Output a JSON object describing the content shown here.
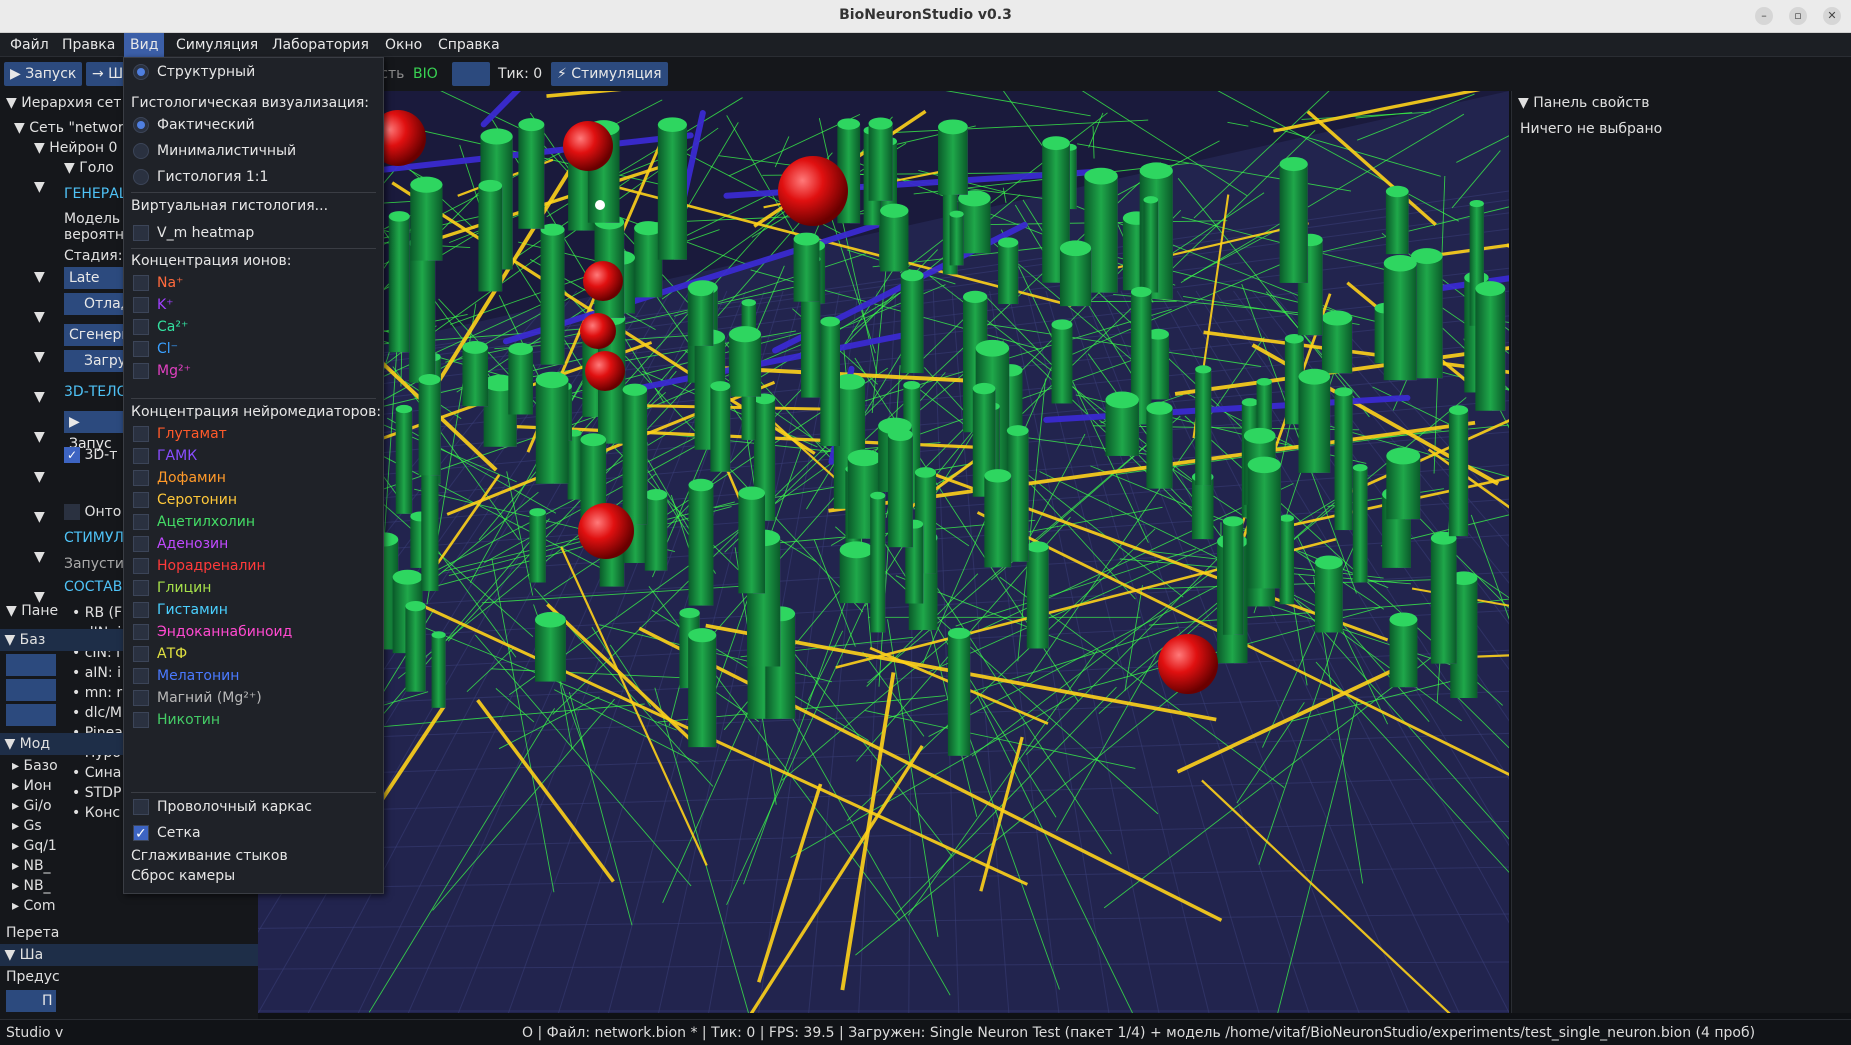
{
  "window": {
    "title": "BioNeuronStudio v0.3"
  },
  "menubar": [
    "Файл",
    "Правка",
    "Вид",
    "Симуляция",
    "Лаборатория",
    "Окно",
    "Справка"
  ],
  "toolbar": {
    "run": "▶ Запуск",
    "step": "→ Ш",
    "speed": "Скорость",
    "bio": "BIO",
    "tick": "Тик: 0",
    "stim": "⚡ Стимуляция"
  },
  "left_panel": {
    "hierarchy_header": "Иерархия сет",
    "network": "Сеть \"networ",
    "neuron": "Нейрон 0",
    "head": "Голо",
    "generator": "ГЕНЕРАЦ",
    "model": "Модель",
    "probability": "вероятн",
    "stage": "Стадия:",
    "late_tail": "Late Tai",
    "debug": "Отлад",
    "generate": "Сгенери",
    "load": "Загру",
    "threed_body": "3D-ТЕЛО",
    "run_btn": "▶ Запус",
    "threed_check": "3D-т",
    "onto": "Онто",
    "stim": "СТИМУЛ",
    "start": "Запусти",
    "composition": "СОСТАВ",
    "panel_header": "Пане",
    "list": [
      "RB (F",
      "dIN: i",
      "cIN: i",
      "aIN: i",
      "mn: r",
      "dlc/M",
      "Pinea",
      "Нуро",
      "Сина",
      "STDP",
      "Конс"
    ],
    "base": "Баз",
    "modifiers_header": "Мод",
    "tree": [
      "Базо",
      "Ион",
      "Gi/o",
      "Gs",
      "Gq/1",
      "NB_",
      "NB_",
      "Com"
    ],
    "drag_hint": "Перета",
    "template_header": "Ша",
    "preset": "Предус",
    "pyramidal_btn": "П"
  },
  "view_menu": {
    "structural": "Структурный",
    "histology_header": "Гистологическая визуализация:",
    "actual": "Фактический",
    "minimal": "Минималистичный",
    "histology11": "Гистология 1:1",
    "virtual_histology": "Виртуальная гистология...",
    "vm_heatmap": "V_m heatmap",
    "ion_header": "Концентрация ионов:",
    "ions": [
      {
        "label": "Na⁺",
        "color": "#ff6a3d"
      },
      {
        "label": "K⁺",
        "color": "#a040ff"
      },
      {
        "label": "Ca²⁺",
        "color": "#33e0a0"
      },
      {
        "label": "Cl⁻",
        "color": "#3aa0ff"
      },
      {
        "label": "Mg²⁺",
        "color": "#e040c0"
      }
    ],
    "nt_header": "Концентрация нейромедиаторов:",
    "neurotransmitters": [
      {
        "label": "Глутамат",
        "color": "#ff5a2a"
      },
      {
        "label": "ГАМК",
        "color": "#8a4dff"
      },
      {
        "label": "Дофамин",
        "color": "#ff9a2a"
      },
      {
        "label": "Серотонин",
        "color": "#ffc83a"
      },
      {
        "label": "Ацетилхолин",
        "color": "#44dd66"
      },
      {
        "label": "Аденозин",
        "color": "#c04aff"
      },
      {
        "label": "Норадреналин",
        "color": "#ff3a3a"
      },
      {
        "label": "Глицин",
        "color": "#a6e04a"
      },
      {
        "label": "Гистамин",
        "color": "#4ad0ff"
      },
      {
        "label": "Эндоканнабиноид",
        "color": "#ff4ad0"
      },
      {
        "label": "АТФ",
        "color": "#e0e040"
      },
      {
        "label": "Мелатонин",
        "color": "#4a7aff"
      },
      {
        "label": "Магний (Mg²⁺)",
        "color": "#b8b8b8"
      },
      {
        "label": "Никотин",
        "color": "#44cc66"
      }
    ],
    "wireframe": "Проволочный каркас",
    "grid": "Сетка",
    "smooth_joints": "Сглаживание стыков",
    "reset_camera": "Сброс камеры"
  },
  "right_panel": {
    "header": "Панель свойств",
    "empty": "Ничего не выбрано"
  },
  "statusbar": {
    "left": "Studio v",
    "right": "O | Файл: network.bion * | Тик: 0 | FPS: 39.5 | Загружен: Single Neuron Test (пакет 1/4) + модель /home/vitaf/BioNeuronStudio/experiments/test_single_neuron.bion (4 проб)"
  },
  "colors": {
    "accent": "#3c5fa8",
    "viewport_bg": "#1a1a3c",
    "axon": "#ffd21a",
    "dendrite": "#33ff44",
    "soma": "#ff1e1e"
  }
}
